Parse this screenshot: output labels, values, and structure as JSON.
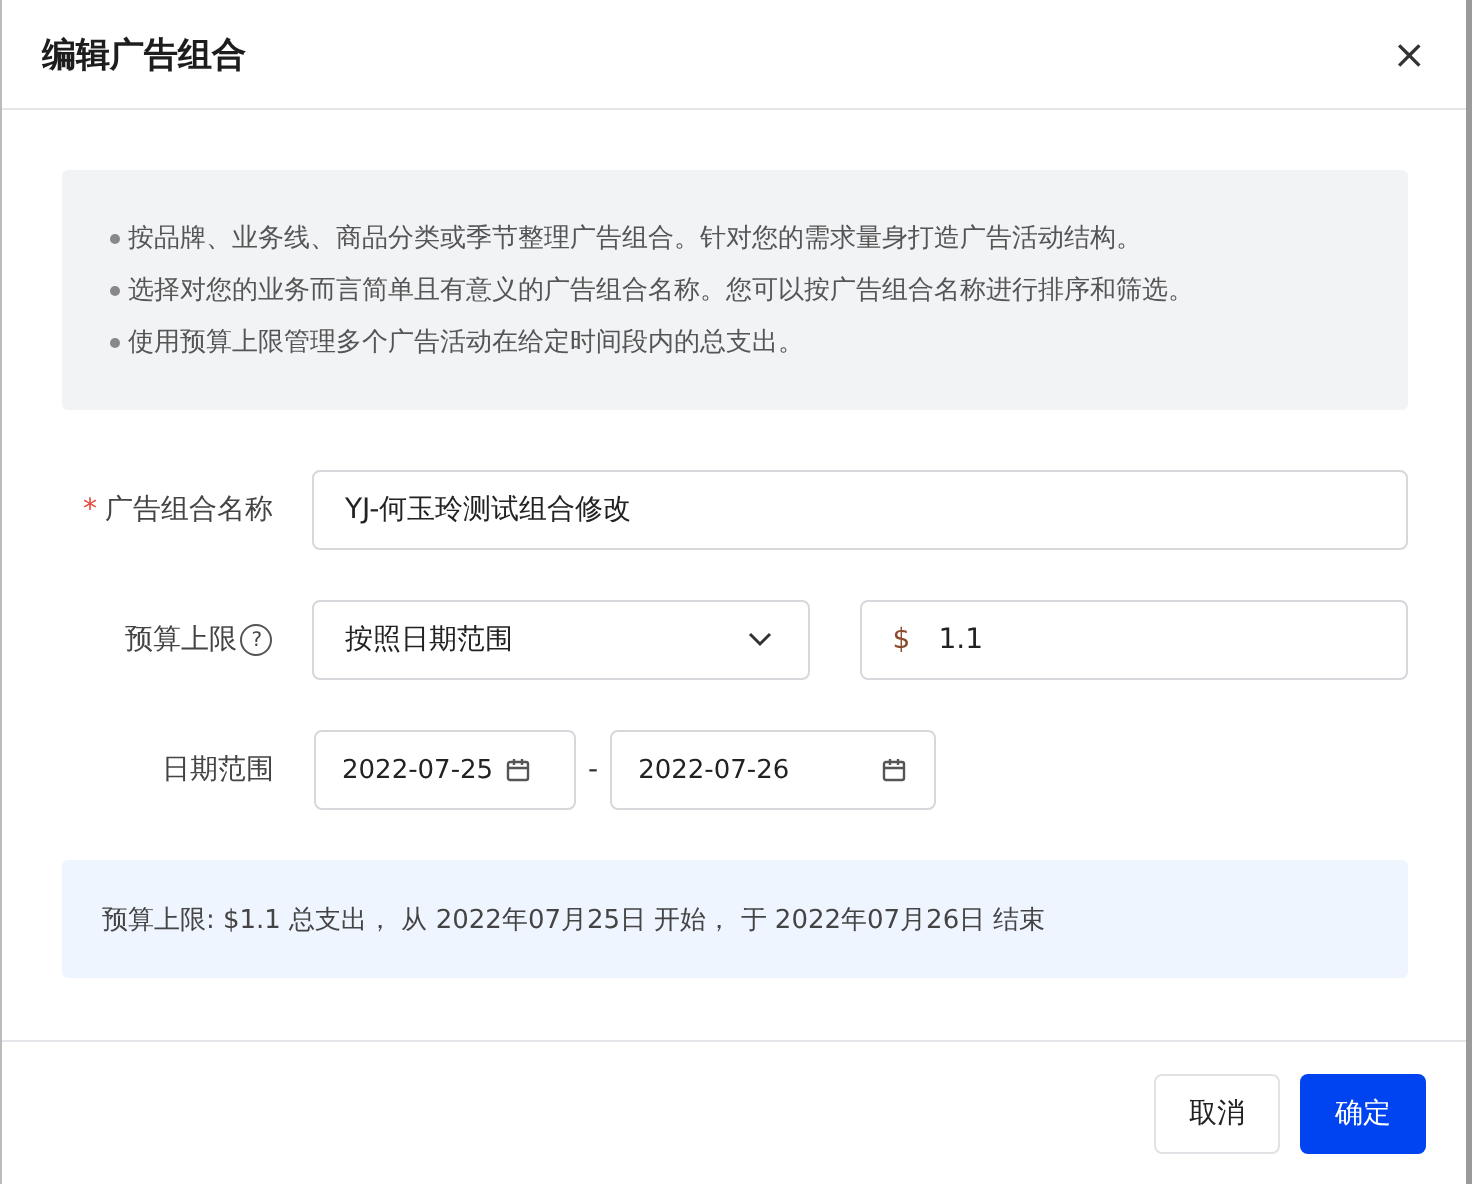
{
  "dialog": {
    "title": "编辑广告组合",
    "close": "×"
  },
  "tips": [
    "按品牌、业务线、商品分类或季节整理广告组合。针对您的需求量身打造广告活动结构。",
    "选择对您的业务而言简单且有意义的广告组合名称。您可以按广告组合名称进行排序和筛选。",
    "使用预算上限管理多个广告活动在给定时间段内的总支出。"
  ],
  "form": {
    "name": {
      "label": "广告组合名称",
      "required_mark": "*",
      "value": "YJ-何玉玲测试组合修改"
    },
    "budget": {
      "label": "预算上限",
      "help": "?",
      "mode": "按照日期范围",
      "currency": "$",
      "amount": "1.1"
    },
    "dates": {
      "label": "日期范围",
      "start": "2022-07-25",
      "separator": "-",
      "end": "2022-07-26"
    }
  },
  "summary": "预算上限: $1.1 总支出， 从 2022年07月25日 开始， 于 2022年07月26日 结束",
  "buttons": [
    {
      "label": "取消",
      "kind": "secondary"
    },
    {
      "label": "确定",
      "kind": "primary"
    }
  ]
}
